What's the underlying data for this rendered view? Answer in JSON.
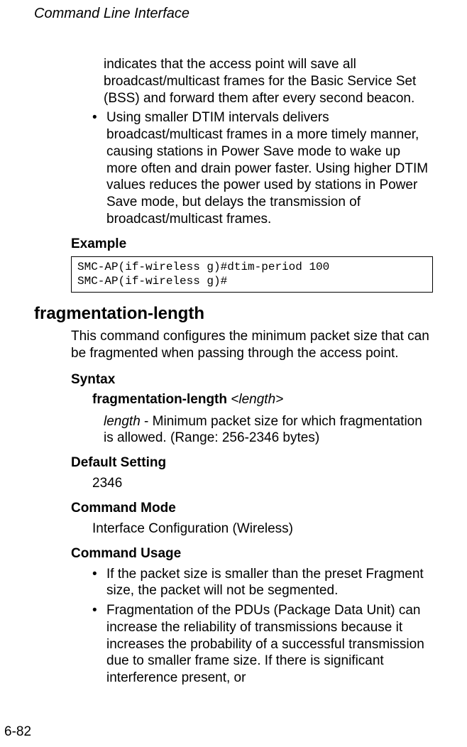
{
  "header": {
    "running_title": "Command Line Interface"
  },
  "top_section": {
    "continued_para": "indicates that the access point will save all broadcast/multicast frames for the Basic Service Set (BSS) and forward them after every second beacon.",
    "bullet_para": "Using smaller DTIM intervals delivers broadcast/multicast frames in a more timely manner, causing stations in Power Save mode to wake up more often and drain power faster. Using higher DTIM values reduces the power used by stations in Power Save mode, but delays the transmission of broadcast/multicast frames.",
    "example_label": "Example",
    "code_block": "SMC-AP(if-wireless g)#dtim-period 100\nSMC-AP(if-wireless g)#"
  },
  "command": {
    "name": "fragmentation-length",
    "description": "This command configures the minimum packet size that can be fragmented when passing through the access point.",
    "syntax_label": "Syntax",
    "syntax_cmd": "fragmentation-length",
    "syntax_arg": "<length>",
    "syntax_desc_term": "length",
    "syntax_desc_rest": " - Minimum packet size for which fragmentation is allowed. (Range: 256-2346 bytes)",
    "default_label": "Default Setting",
    "default_value": "2346",
    "mode_label": "Command Mode",
    "mode_value": "Interface Configuration (Wireless)",
    "usage_label": "Command Usage",
    "usage_bullets": [
      "If the packet size is smaller than the preset Fragment size, the packet will not be segmented.",
      "Fragmentation of the PDUs (Package Data Unit) can increase the reliability of transmissions because it increases the probability of a successful transmission due to smaller frame size. If there is significant interference present, or"
    ]
  },
  "footer": {
    "page_number": "6-82"
  }
}
